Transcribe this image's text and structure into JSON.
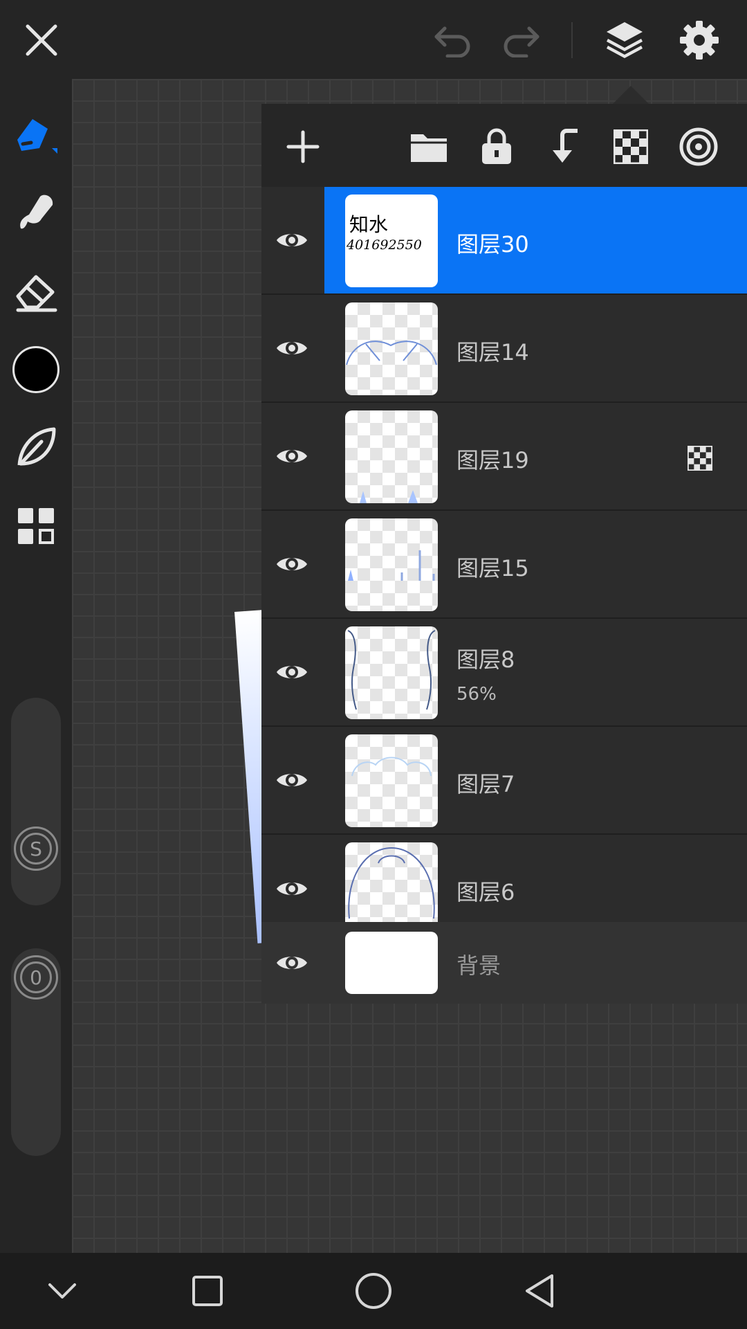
{
  "topbar": {
    "close_icon": "close-icon",
    "undo_icon": "undo-icon",
    "redo_icon": "redo-icon",
    "layers_icon": "layers-icon",
    "settings_icon": "gear-icon"
  },
  "tools": {
    "brush": "brush-icon",
    "smudge": "smudge-icon",
    "eraser": "eraser-icon",
    "color": "#000000",
    "leaf": "leaf-icon",
    "grid": "grid-icon",
    "accent": "#0a74f5"
  },
  "sliders": {
    "size_label": "S",
    "opacity_label": "0"
  },
  "layers_panel": {
    "toolbar": [
      "add-icon",
      "folder-icon",
      "lock-icon",
      "merge-down-icon",
      "checker-icon",
      "target-icon"
    ],
    "layers": [
      {
        "name": "图层30",
        "opacity": "",
        "selected": true,
        "thumb_note_line1": "知水",
        "thumb_note_line2": "401692550"
      },
      {
        "name": "图层14",
        "opacity": "",
        "selected": false
      },
      {
        "name": "图层19",
        "opacity": "",
        "selected": false,
        "clipping": true
      },
      {
        "name": "图层15",
        "opacity": "",
        "selected": false
      },
      {
        "name": "图层8",
        "opacity": "56%",
        "selected": false
      },
      {
        "name": "图层7",
        "opacity": "",
        "selected": false
      },
      {
        "name": "图层6",
        "opacity": "",
        "selected": false
      }
    ],
    "background": {
      "name": "背景"
    }
  },
  "navbar": {
    "back": "chevron-down-icon",
    "recents": "square-icon",
    "home": "circle-icon",
    "nav_back": "triangle-back-icon"
  }
}
